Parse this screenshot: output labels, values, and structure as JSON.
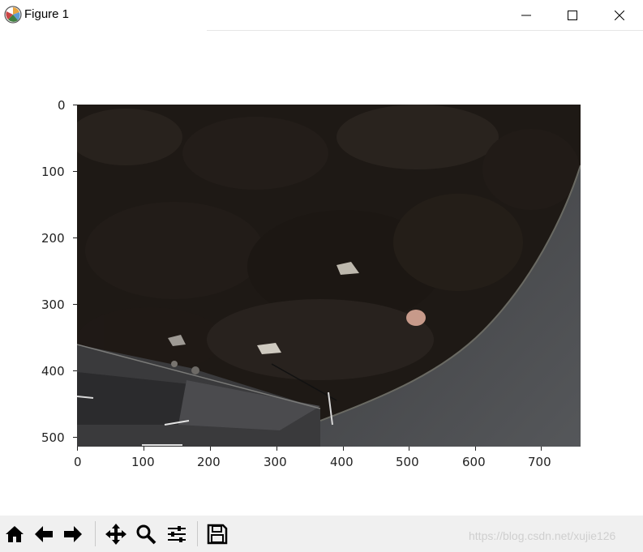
{
  "window": {
    "title": "Figure 1",
    "app_icon": "matplotlib-logo-icon",
    "controls": [
      "minimize-icon",
      "maximize-icon",
      "close-icon"
    ]
  },
  "plot": {
    "type": "image",
    "description_colors": {
      "foliage": "#1f1a16",
      "pavement": "#4a4a4c"
    },
    "x_ticks": [
      "0",
      "100",
      "200",
      "300",
      "400",
      "500",
      "600",
      "700"
    ],
    "y_ticks": [
      "0",
      "100",
      "200",
      "300",
      "400",
      "500"
    ],
    "x_range": [
      0,
      760
    ],
    "y_range": [
      0,
      516
    ]
  },
  "toolbar": {
    "buttons": [
      "home-icon",
      "back-icon",
      "forward-icon",
      "pan-icon",
      "zoom-icon",
      "configure-subplots-icon",
      "save-icon"
    ]
  },
  "watermark": "https://blog.csdn.net/xujie126"
}
